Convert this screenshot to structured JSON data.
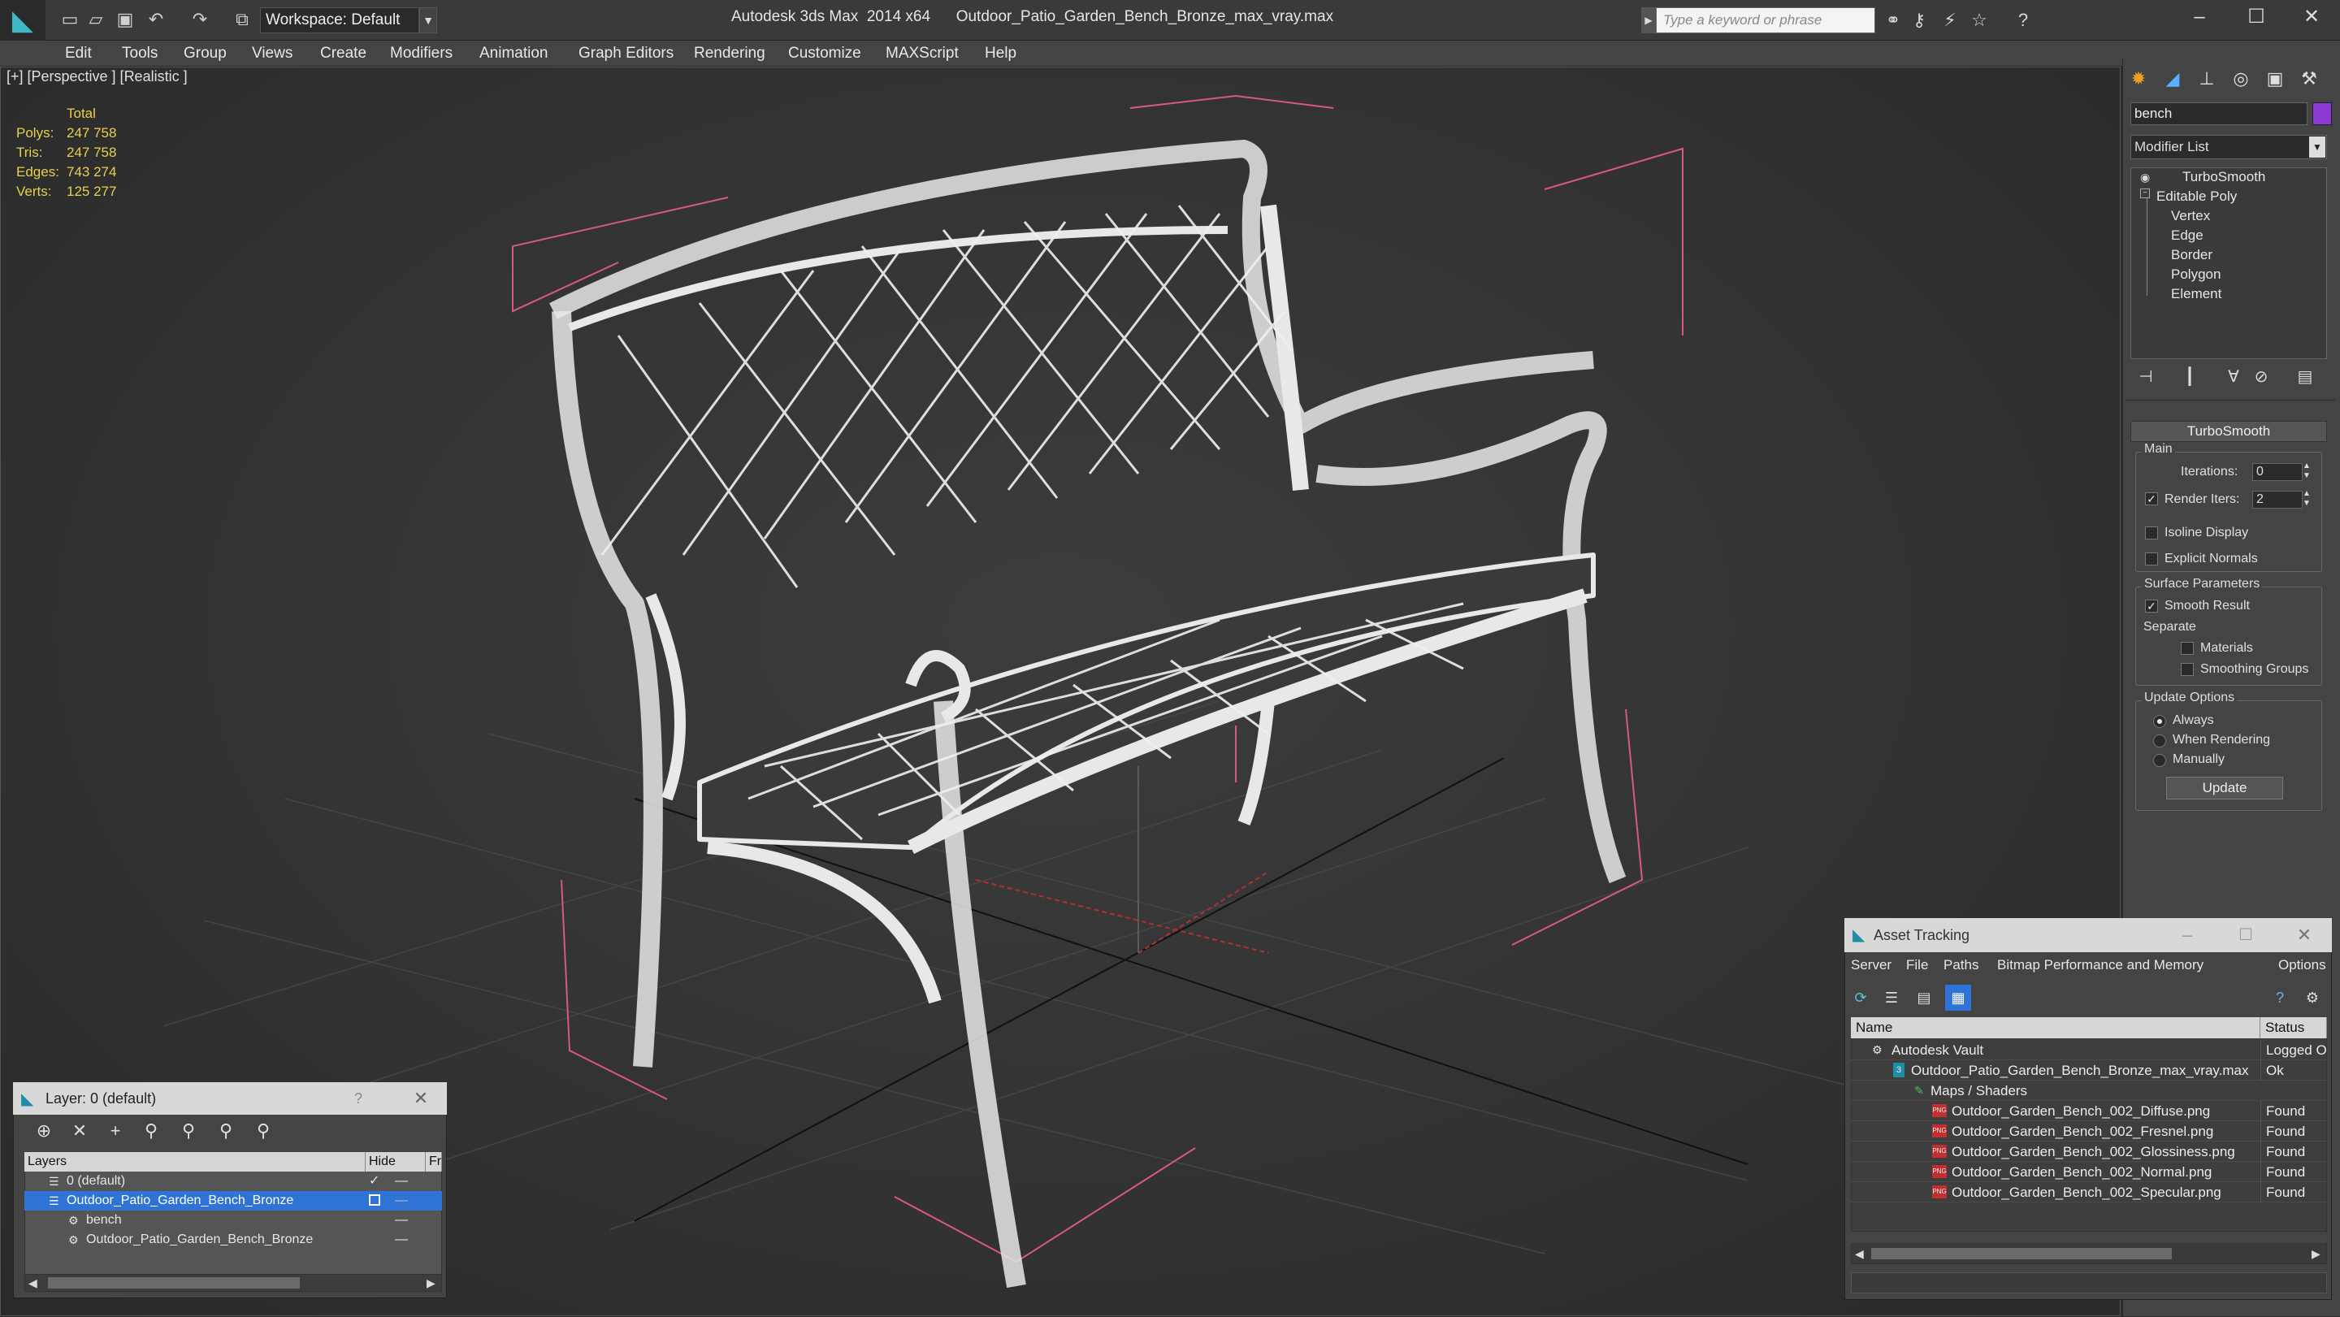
{
  "app": {
    "title": "Autodesk 3ds Max  2014 x64      Outdoor_Patio_Garden_Bench_Bronze_max_vray.max",
    "workspace": "Workspace: Default",
    "search_placeholder": "Type a keyword or phrase"
  },
  "menu": [
    "Edit",
    "Tools",
    "Group",
    "Views",
    "Create",
    "Modifiers",
    "Animation",
    "Graph Editors",
    "Rendering",
    "Customize",
    "MAXScript",
    "Help"
  ],
  "viewport": {
    "label": "[+] [Perspective ] [Realistic ]",
    "stats": {
      "header": "Total",
      "rows": [
        {
          "label": "Polys:",
          "value": "247 758"
        },
        {
          "label": "Tris:",
          "value": "247 758"
        },
        {
          "label": "Edges:",
          "value": "743 274"
        },
        {
          "label": "Verts:",
          "value": "125 277"
        }
      ]
    }
  },
  "command_panel": {
    "object_name": "bench",
    "object_color": "#8e3bd4",
    "modifier_list": "Modifier List",
    "stack": {
      "top": "TurboSmooth",
      "base": "Editable Poly",
      "sub": [
        "Vertex",
        "Edge",
        "Border",
        "Polygon",
        "Element"
      ]
    },
    "rollout": {
      "title": "TurboSmooth",
      "main_label": "Main",
      "iterations_label": "Iterations:",
      "iterations_value": "0",
      "render_iters_label": "Render Iters:",
      "render_iters_value": "2",
      "render_iters_checked": true,
      "isoline_label": "Isoline Display",
      "explicit_label": "Explicit Normals",
      "surface_label": "Surface Parameters",
      "smooth_label": "Smooth Result",
      "separate_label": "Separate",
      "materials_label": "Materials",
      "smoothing_groups_label": "Smoothing Groups",
      "update_options_label": "Update Options",
      "always_label": "Always",
      "when_rendering_label": "When Rendering",
      "manually_label": "Manually",
      "update_button": "Update"
    }
  },
  "layer_dialog": {
    "title": "Layer: 0 (default)",
    "help": "?",
    "columns": [
      "Layers",
      "Hide",
      "Fr"
    ],
    "rows": [
      {
        "name": "0 (default)",
        "level": 1
      },
      {
        "name": "Outdoor_Patio_Garden_Bench_Bronze",
        "level": 1,
        "selected": true
      },
      {
        "name": "bench",
        "level": 2
      },
      {
        "name": "Outdoor_Patio_Garden_Bench_Bronze",
        "level": 2
      }
    ]
  },
  "asset_tracking": {
    "title": "Asset Tracking",
    "menu": [
      "Server",
      "File",
      "Paths",
      "Bitmap Performance and Memory",
      "Options"
    ],
    "columns": [
      "Name",
      "Status"
    ],
    "rows": [
      {
        "name": "Autodesk Vault",
        "status": "Logged O",
        "level": 0
      },
      {
        "name": "Outdoor_Patio_Garden_Bench_Bronze_max_vray.max",
        "status": "Ok",
        "level": 1
      },
      {
        "name": "Maps / Shaders",
        "status": "",
        "level": 2
      },
      {
        "name": "Outdoor_Garden_Bench_002_Diffuse.png",
        "status": "Found",
        "level": 3
      },
      {
        "name": "Outdoor_Garden_Bench_002_Fresnel.png",
        "status": "Found",
        "level": 3
      },
      {
        "name": "Outdoor_Garden_Bench_002_Glossiness.png",
        "status": "Found",
        "level": 3
      },
      {
        "name": "Outdoor_Garden_Bench_002_Normal.png",
        "status": "Found",
        "level": 3
      },
      {
        "name": "Outdoor_Garden_Bench_002_Specular.png",
        "status": "Found",
        "level": 3
      }
    ]
  }
}
